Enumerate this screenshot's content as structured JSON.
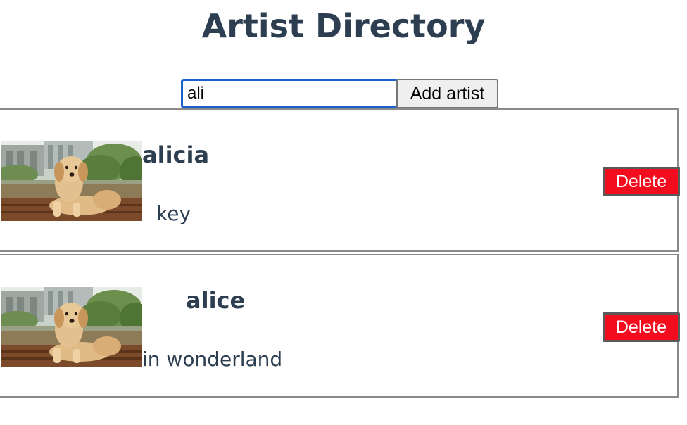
{
  "header": {
    "title": "Artist Directory"
  },
  "search": {
    "value": "ali",
    "add_label": "Add artist"
  },
  "artists": [
    {
      "name": "alicia",
      "description": "key",
      "delete_label": "Delete"
    },
    {
      "name": "alice",
      "description": "in wonderland",
      "delete_label": "Delete"
    }
  ],
  "colors": {
    "text": "#2c3e50",
    "delete": "#f20c1e",
    "focus": "#1a62c7"
  }
}
